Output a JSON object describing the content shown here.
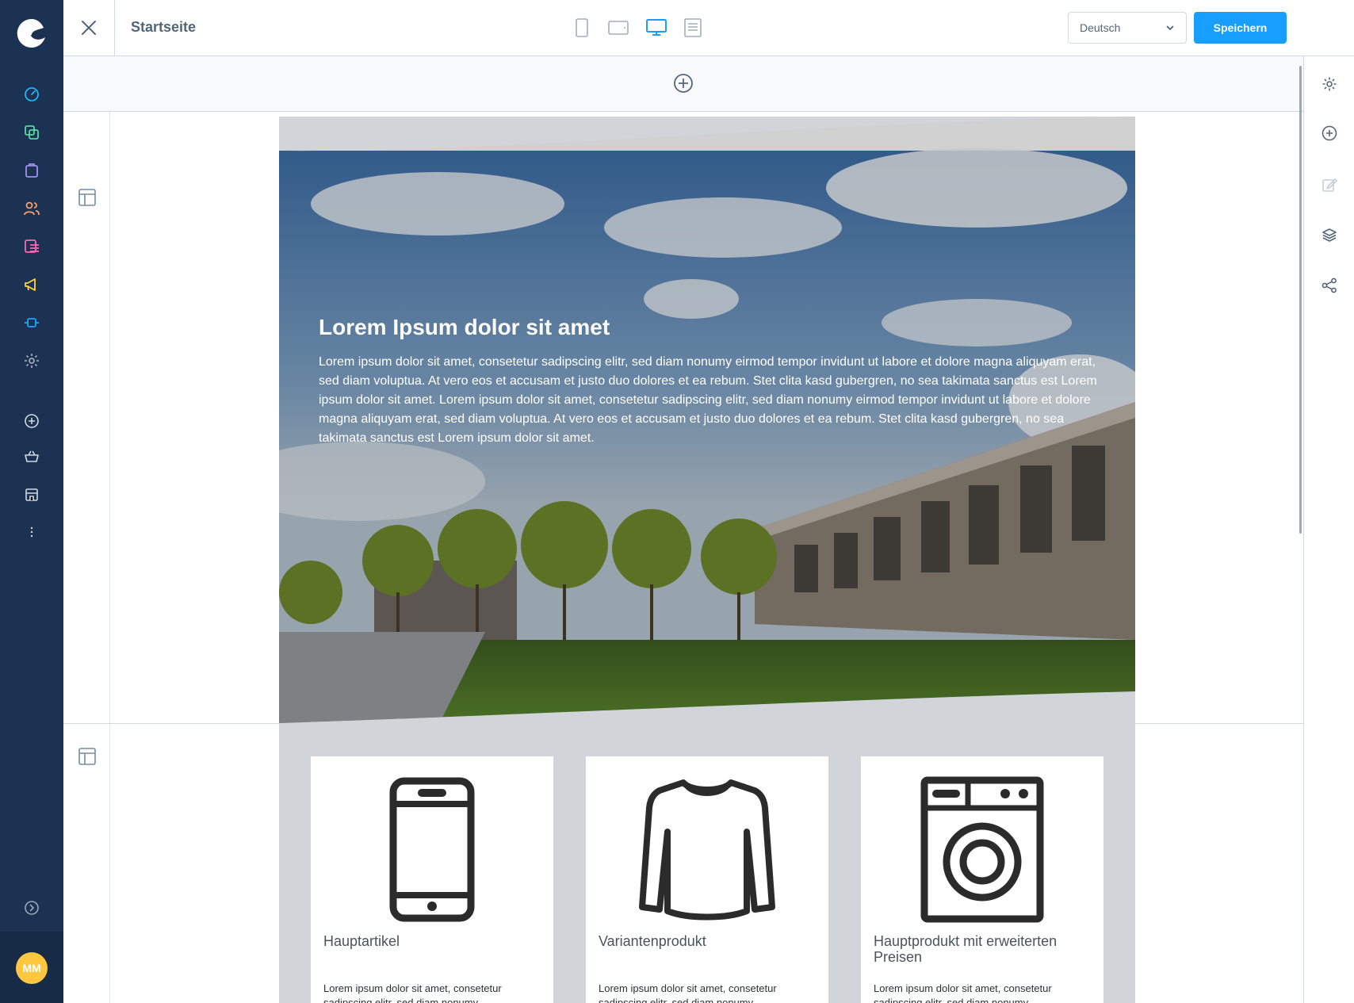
{
  "topbar": {
    "page_title": "Startseite",
    "language": "Deutsch",
    "save_label": "Speichern",
    "devices": [
      "mobile",
      "tablet",
      "desktop",
      "form"
    ],
    "active_device": "desktop"
  },
  "user": {
    "initials": "MM"
  },
  "nav": {
    "items": [
      "dashboard-icon",
      "catalogue-icon",
      "orders-icon",
      "customers-icon",
      "content-icon",
      "marketing-icon",
      "extensions-icon",
      "settings-icon",
      "add-icon",
      "basket-icon",
      "storefront-icon",
      "more-icon"
    ],
    "colors": {
      "dashboard": "#1fb5fb",
      "catalogue": "#57d9a3",
      "orders": "#a092f0",
      "customers": "#ff9f66",
      "content": "#ff68b4",
      "marketing": "#ffd53d",
      "extensions": "#1ea7ff",
      "settings": "#9aa8b5"
    }
  },
  "hero": {
    "title": "Lorem Ipsum dolor sit amet",
    "body": "Lorem ipsum dolor sit amet, consetetur sadipscing elitr, sed diam nonumy eirmod tempor invidunt ut labore et dolore magna aliquyam erat, sed diam voluptua. At vero eos et accusam et justo duo dolores et ea rebum. Stet clita kasd gubergren, no sea takimata sanctus est Lorem ipsum dolor sit amet. Lorem ipsum dolor sit amet, consetetur sadipscing elitr, sed diam nonumy eirmod tempor invidunt ut labore et dolore magna aliquyam erat, sed diam voluptua. At vero eos et accusam et justo duo dolores et ea rebum. Stet clita kasd gubergren, no sea takimata sanctus est Lorem ipsum dolor sit amet."
  },
  "products": [
    {
      "name": "Hauptartikel",
      "icon": "smartphone-icon",
      "desc": "Lorem ipsum dolor sit amet, consetetur sadipscing elitr, sed diam nonumy"
    },
    {
      "name": "Variantenprodukt",
      "icon": "sweater-icon",
      "desc": "Lorem ipsum dolor sit amet, consetetur sadipscing elitr, sed diam nonumy"
    },
    {
      "name": "Hauptprodukt mit erweiterten Preisen",
      "icon": "washing-machine-icon",
      "desc": "Lorem ipsum dolor sit amet, consetetur sadipscing elitr, sed diam nonumy"
    }
  ],
  "right_sidebar": [
    "settings-icon",
    "add-block-icon",
    "edit-icon",
    "layers-icon",
    "share-icon"
  ]
}
